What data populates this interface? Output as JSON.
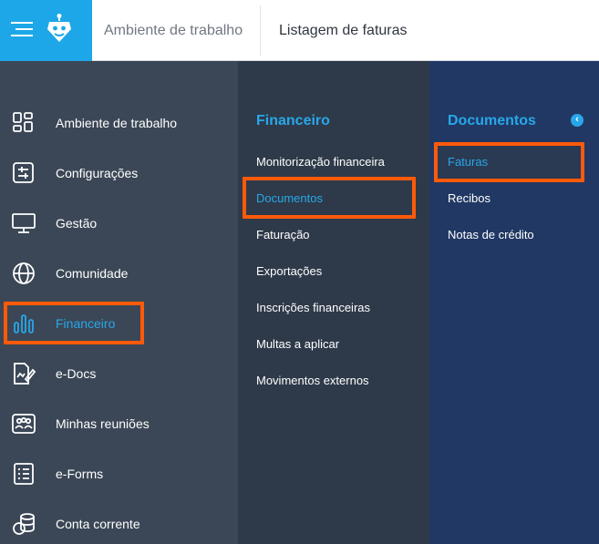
{
  "header": {
    "breadcrumb": [
      "Ambiente de trabalho",
      "Listagem de faturas"
    ]
  },
  "main_menu": [
    {
      "label": "Ambiente de trabalho",
      "icon": "dashboard-grid-icon"
    },
    {
      "label": "Configurações",
      "icon": "settings-sliders-icon"
    },
    {
      "label": "Gestão",
      "icon": "monitor-icon"
    },
    {
      "label": "Comunidade",
      "icon": "globe-icon"
    },
    {
      "label": "Financeiro",
      "icon": "bar-chart-icon",
      "active": true
    },
    {
      "label": "e-Docs",
      "icon": "document-edit-icon"
    },
    {
      "label": "Minhas reuniões",
      "icon": "meeting-people-icon"
    },
    {
      "label": "e-Forms",
      "icon": "form-checklist-icon"
    },
    {
      "label": "Conta corrente",
      "icon": "coins-stack-icon"
    }
  ],
  "sub_menu": {
    "title": "Financeiro",
    "items": [
      "Monitorização financeira",
      "Documentos",
      "Faturação",
      "Exportações",
      "Inscrições financeiras",
      "Multas a aplicar",
      "Movimentos externos"
    ],
    "active_index": 1
  },
  "third_menu": {
    "title": "Documentos",
    "items": [
      "Faturas",
      "Recibos",
      "Notas de crédito"
    ],
    "active_index": 0
  },
  "colors": {
    "accent": "#28a7ea",
    "brand": "#1ea7e8",
    "highlight": "#ff5a0a",
    "panel_left": "#3b4756",
    "panel_mid": "#2e3a49",
    "panel_right": "#203863"
  }
}
